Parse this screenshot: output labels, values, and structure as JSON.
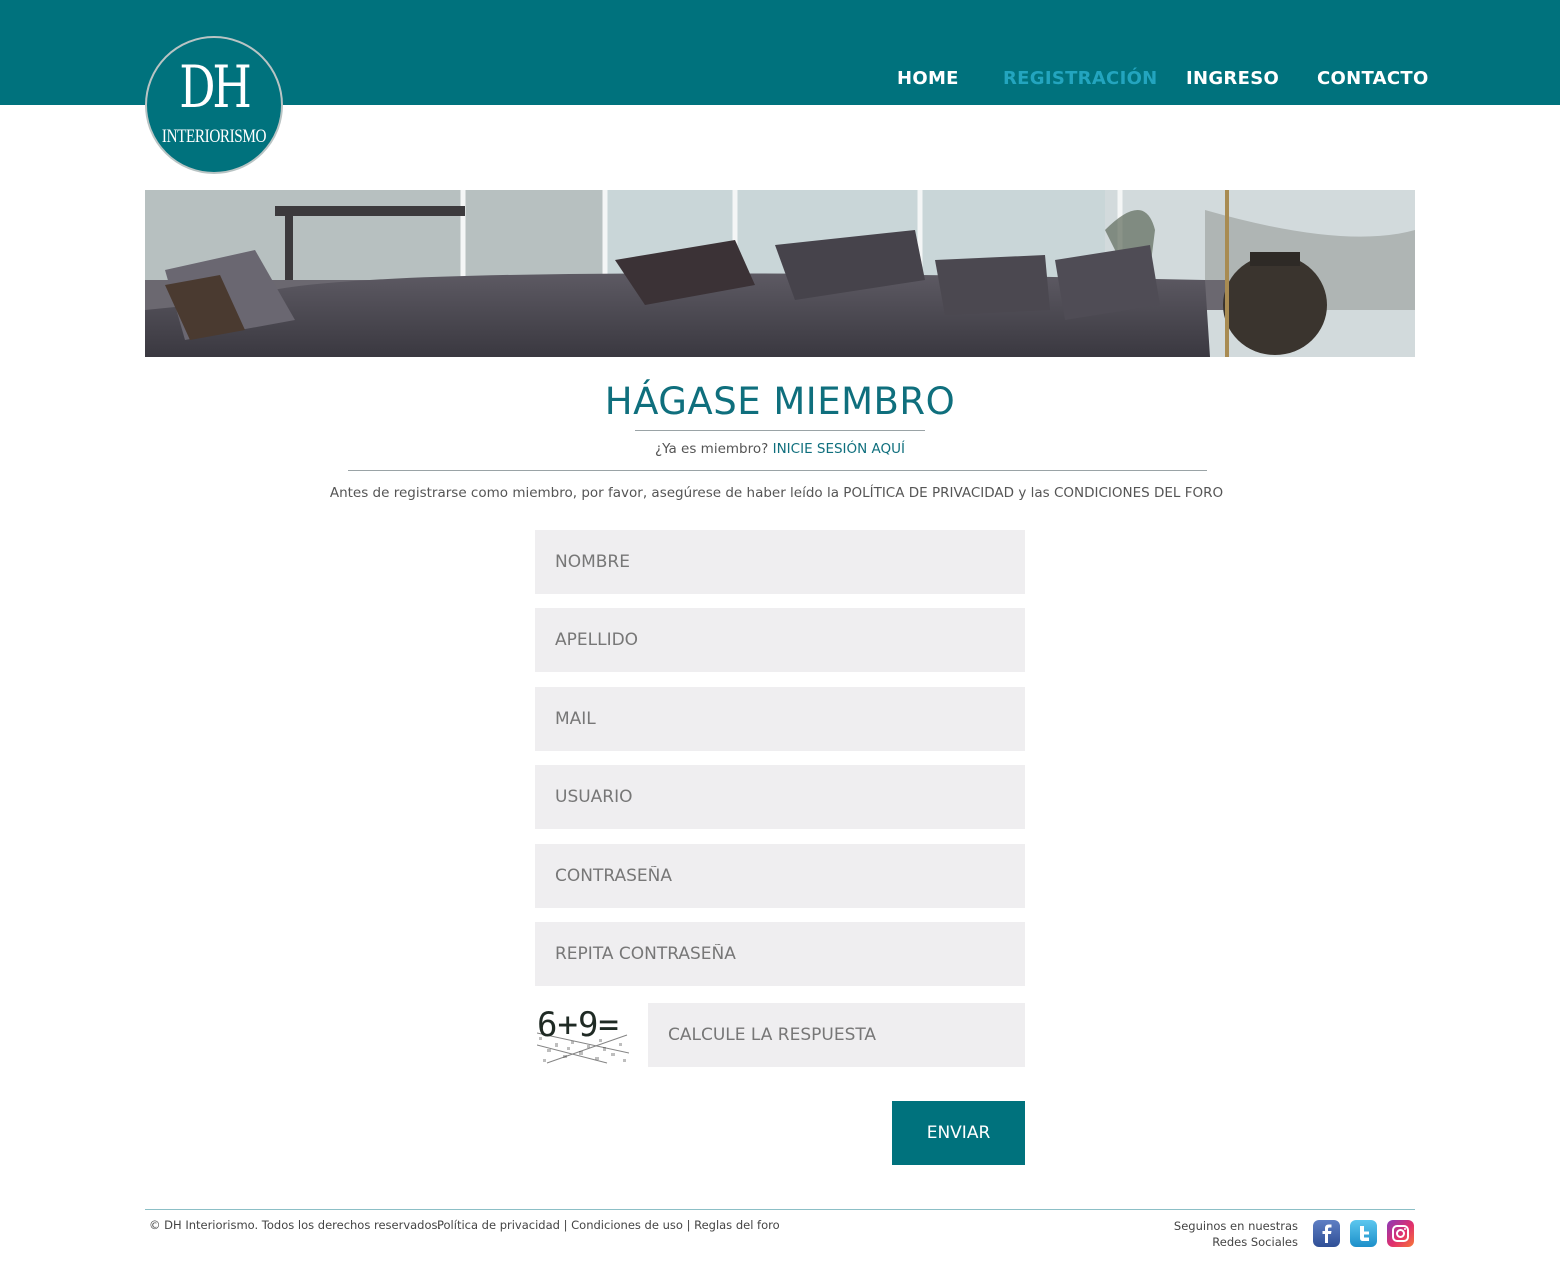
{
  "header": {
    "logo": {
      "main": "DH",
      "sub": "INTERIORISMO"
    },
    "nav": [
      {
        "label": "HOME"
      },
      {
        "label": "REGISTRACIÓN",
        "active": true
      },
      {
        "label": "INGRESO"
      },
      {
        "label": "CONTACTO"
      }
    ]
  },
  "page": {
    "title": "HÁGASE MIEMBRO",
    "member_prompt": "¿Ya es miembro?",
    "member_link": "INICIE SESIÓN AQUÍ",
    "notice": "Antes de registrarse como miembro, por favor, asegúrese de haber leído la POLÍTICA DE PRIVACIDAD y las CONDICIONES DEL FORO"
  },
  "form": {
    "nombre_placeholder": "NOMBRE",
    "apellido_placeholder": "APELLIDO",
    "mail_placeholder": "MAIL",
    "usuario_placeholder": "USUARIO",
    "password_placeholder": "CONTRASEÑA",
    "password_repeat_placeholder": "REPITA CONTRASEÑA",
    "captcha_text": "6+9=",
    "captcha_placeholder": "CALCULE LA RESPUESTA",
    "submit_label": "ENVIAR"
  },
  "footer": {
    "copyright": "© DH Interiorismo. Todos los derechos reservados.",
    "links": [
      "Política de privacidad",
      "Condiciones de uso",
      "Reglas del foro"
    ],
    "separator": "|",
    "social_line1": "Seguinos en nuestras",
    "social_line2": "Redes Sociales",
    "social_icons": [
      "facebook-icon",
      "twitter-icon",
      "instagram-icon"
    ]
  },
  "colors": {
    "brand": "#00727d",
    "active_nav": "#23a5bf",
    "field_bg": "#efeef0"
  }
}
